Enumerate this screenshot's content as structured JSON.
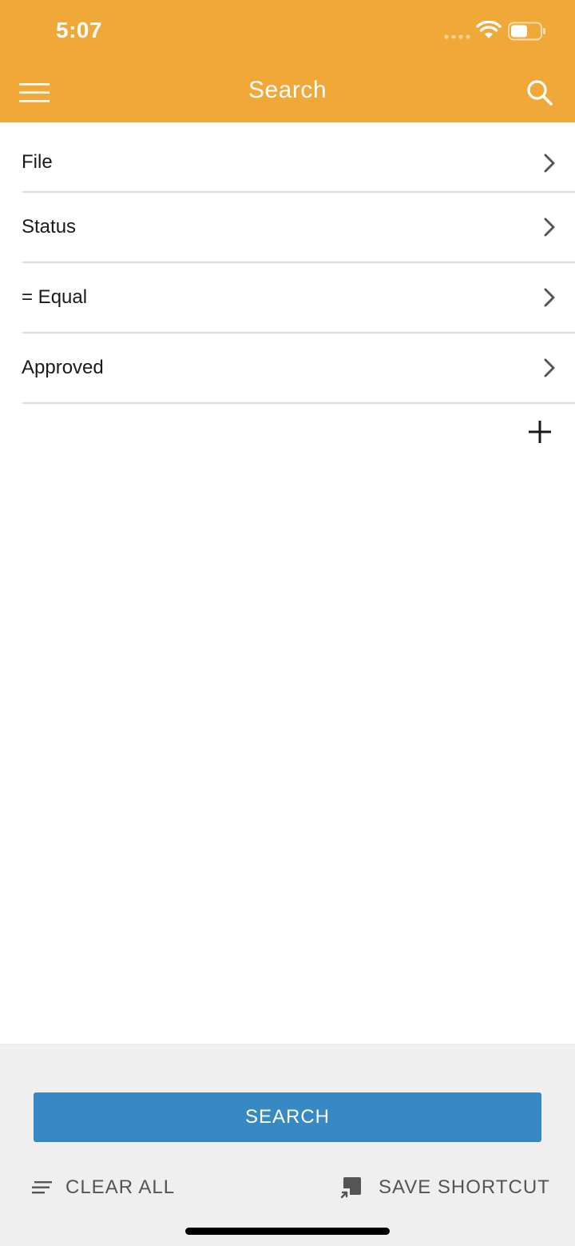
{
  "status_bar": {
    "time": "5:07"
  },
  "app_bar": {
    "title": "Search",
    "menu_icon": "hamburger-menu-icon",
    "search_icon": "search-icon"
  },
  "criteria": [
    {
      "label": "File"
    },
    {
      "label": "Status"
    },
    {
      "label": "= Equal"
    },
    {
      "label": "Approved"
    }
  ],
  "add_icon": "plus-icon",
  "footer": {
    "search_label": "SEARCH",
    "clear_all_label": "CLEAR ALL",
    "save_shortcut_label": "SAVE SHORTCUT"
  },
  "colors": {
    "header": "#F0A838",
    "primary_button": "#3689C2",
    "footer_bg": "#EFEFEF"
  }
}
